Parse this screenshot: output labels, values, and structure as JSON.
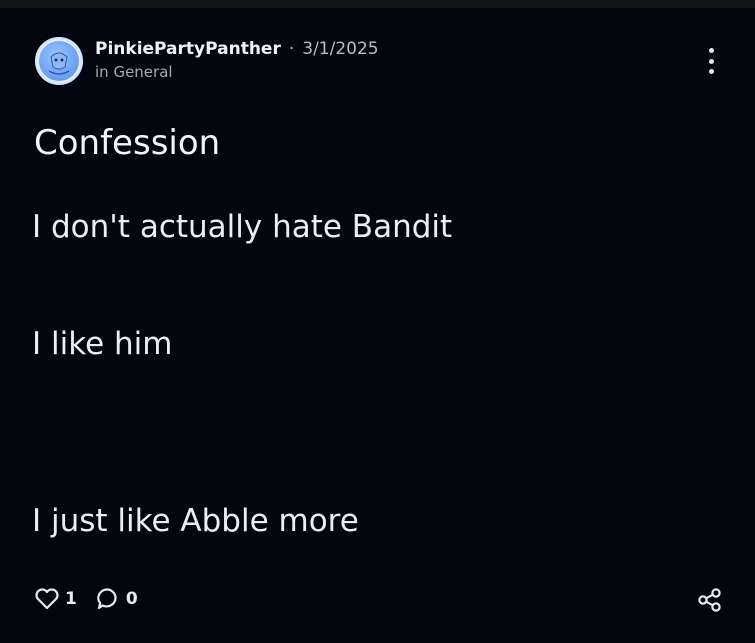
{
  "post": {
    "author": "PinkiePartyPanther",
    "separator": "·",
    "date": "3/1/2025",
    "community": "in General",
    "title": "Confession",
    "body_lines": [
      "I don't actually hate Bandit",
      "I like him",
      "I just like Abble more"
    ]
  },
  "actions": {
    "like_icon": "heart-icon",
    "like_count": "1",
    "comment_icon": "comment-bubble-icon",
    "comment_count": "0",
    "share_icon": "share-icon",
    "menu_icon": "more-vertical-icon"
  },
  "colors": {
    "background": "#04060f",
    "text_primary": "#f2f3f7",
    "text_secondary": "#a7a9b3",
    "avatar_blue": "#6aa0f5"
  }
}
